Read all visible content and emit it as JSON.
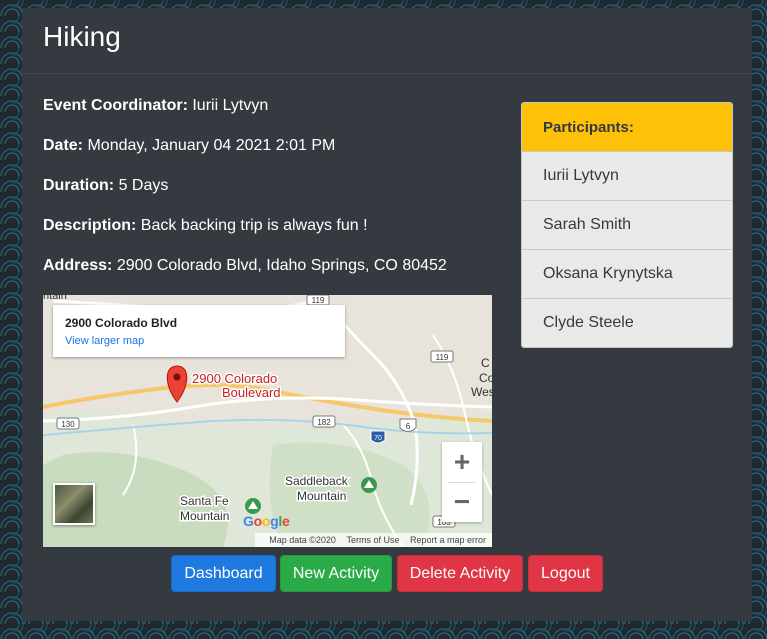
{
  "event": {
    "title": "Hiking",
    "coordinator_label": "Event Coordinator:",
    "coordinator": "Iurii Lytvyn",
    "date_label": "Date:",
    "date": "Monday, January 04 2021 2:01 PM",
    "duration_label": "Duration:",
    "duration": "5 Days",
    "description_label": "Description:",
    "description": "Back backing trip is always fun !",
    "address_label": "Address:",
    "address": "2900 Colorado Blvd, Idaho Springs, CO 80452"
  },
  "map": {
    "place_title": "2900 Colorado Blvd",
    "larger_map_link": "View larger map",
    "marker_label_line1": "2900 Colorado",
    "marker_label_line2": "Boulevard",
    "labels": {
      "colorado_west_1": "C",
      "colorado_west_2": "Co",
      "colorado_west_3": "Wes",
      "santa_fe_1": "Santa Fe",
      "santa_fe_2": "Mountain",
      "saddleback_1": "Saddleback",
      "saddleback_2": "Mountain",
      "tain": "ntain"
    },
    "route_shields": [
      "119",
      "119",
      "130",
      "182",
      "70",
      "6",
      "103"
    ],
    "google_logo": "Google",
    "attribution": {
      "map_data": "Map data ©2020",
      "terms": "Terms of Use",
      "report": "Report a map error"
    },
    "zoom_in": "+",
    "zoom_out": "−"
  },
  "participants": {
    "header": "Participants:",
    "items": [
      "Iurii Lytvyn",
      "Sarah Smith",
      "Oksana Krynytska",
      "Clyde Steele"
    ]
  },
  "buttons": {
    "dashboard": "Dashboard",
    "new_activity": "New Activity",
    "delete_activity": "Delete Activity",
    "logout": "Logout"
  },
  "colors": {
    "card_bg": "#343a40",
    "participants_header": "#ffc107",
    "primary": "#1f7ae0",
    "success": "#2bab47",
    "danger": "#e03545"
  }
}
